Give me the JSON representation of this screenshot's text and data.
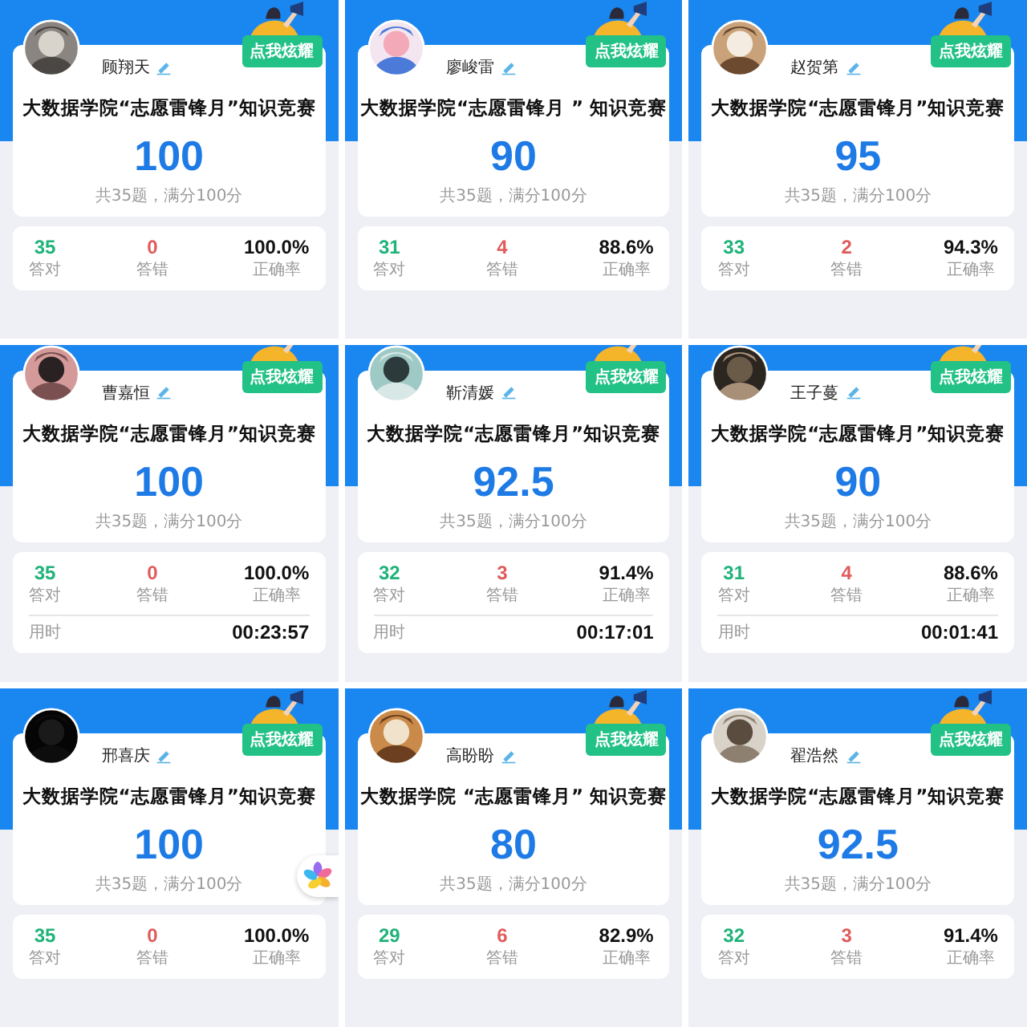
{
  "tiles": [
    {
      "name": "顾翔天",
      "badge": "点我炫耀",
      "title": "大数据学院“志愿雷锋月”知识竞赛",
      "score": "100",
      "summary": "共35题，满分100分",
      "floating_icon": false,
      "stats": [
        {
          "kind": "correct",
          "value": "35",
          "label": "答对"
        },
        {
          "kind": "wrong",
          "value": "0",
          "label": "答错"
        },
        {
          "kind": "rate",
          "value": "100.0%",
          "label": "正确率"
        }
      ]
    },
    {
      "name": "廖峻雷",
      "badge": "点我炫耀",
      "title": "大数据学院“志愿雷锋月 ” 知识竞赛",
      "score": "90",
      "summary": "共35题，满分100分",
      "floating_icon": false,
      "stats": [
        {
          "kind": "correct",
          "value": "31",
          "label": "答对"
        },
        {
          "kind": "wrong",
          "value": "4",
          "label": "答错"
        },
        {
          "kind": "rate",
          "value": "88.6%",
          "label": "正确率"
        }
      ]
    },
    {
      "name": "赵贺第",
      "badge": "点我炫耀",
      "title": "大数据学院“志愿雷锋月”知识竞赛",
      "score": "95",
      "summary": "共35题，满分100分",
      "floating_icon": false,
      "stats": [
        {
          "kind": "correct",
          "value": "33",
          "label": "答对"
        },
        {
          "kind": "wrong",
          "value": "2",
          "label": "答错"
        },
        {
          "kind": "rate",
          "value": "94.3%",
          "label": "正确率"
        }
      ]
    },
    {
      "name": "曹嘉恒",
      "badge": "点我炫耀",
      "title": "大数据学院“志愿雷锋月”知识竞赛",
      "score": "100",
      "summary": "共35题，满分100分",
      "floating_icon": false,
      "stats": [
        {
          "kind": "correct",
          "value": "35",
          "label": "答对"
        },
        {
          "kind": "wrong",
          "value": "0",
          "label": "答错"
        },
        {
          "kind": "rate",
          "value": "100.0%",
          "label": "正确率"
        }
      ],
      "time_label": "用时",
      "time": "00:23:57"
    },
    {
      "name": "靳清媛",
      "badge": "点我炫耀",
      "title": "大数据学院“志愿雷锋月”知识竞赛",
      "score": "92.5",
      "summary": "共35题，满分100分",
      "floating_icon": false,
      "stats": [
        {
          "kind": "correct",
          "value": "32",
          "label": "答对"
        },
        {
          "kind": "wrong",
          "value": "3",
          "label": "答错"
        },
        {
          "kind": "rate",
          "value": "91.4%",
          "label": "正确率"
        }
      ],
      "time_label": "用时",
      "time": "00:17:01"
    },
    {
      "name": "王子蔓",
      "badge": "点我炫耀",
      "title": "大数据学院“志愿雷锋月”知识竞赛",
      "score": "90",
      "summary": "共35题，满分100分",
      "floating_icon": false,
      "stats": [
        {
          "kind": "correct",
          "value": "31",
          "label": "答对"
        },
        {
          "kind": "wrong",
          "value": "4",
          "label": "答错"
        },
        {
          "kind": "rate",
          "value": "88.6%",
          "label": "正确率"
        }
      ],
      "time_label": "用时",
      "time": "00:01:41"
    },
    {
      "name": "邢喜庆",
      "badge": "点我炫耀",
      "title": "大数据学院“志愿雷锋月”知识竞赛",
      "score": "100",
      "summary": "共35题，满分100分",
      "floating_icon": true,
      "stats": [
        {
          "kind": "correct",
          "value": "35",
          "label": "答对"
        },
        {
          "kind": "wrong",
          "value": "0",
          "label": "答错"
        },
        {
          "kind": "rate",
          "value": "100.0%",
          "label": "正确率"
        }
      ]
    },
    {
      "name": "高盼盼",
      "badge": "点我炫耀",
      "title": "大数据学院 “志愿雷锋月” 知识竞赛",
      "score": "80",
      "summary": "共35题，满分100分",
      "floating_icon": false,
      "stats": [
        {
          "kind": "correct",
          "value": "29",
          "label": "答对"
        },
        {
          "kind": "wrong",
          "value": "6",
          "label": "答错"
        },
        {
          "kind": "rate",
          "value": "82.9%",
          "label": "正确率"
        }
      ]
    },
    {
      "name": "翟浩然",
      "badge": "点我炫耀",
      "title": "大数据学院“志愿雷锋月”知识竞赛",
      "score": "92.5",
      "summary": "共35题，满分100分",
      "floating_icon": false,
      "stats": [
        {
          "kind": "correct",
          "value": "32",
          "label": "答对"
        },
        {
          "kind": "wrong",
          "value": "3",
          "label": "答错"
        },
        {
          "kind": "rate",
          "value": "91.4%",
          "label": "正确率"
        }
      ]
    }
  ]
}
